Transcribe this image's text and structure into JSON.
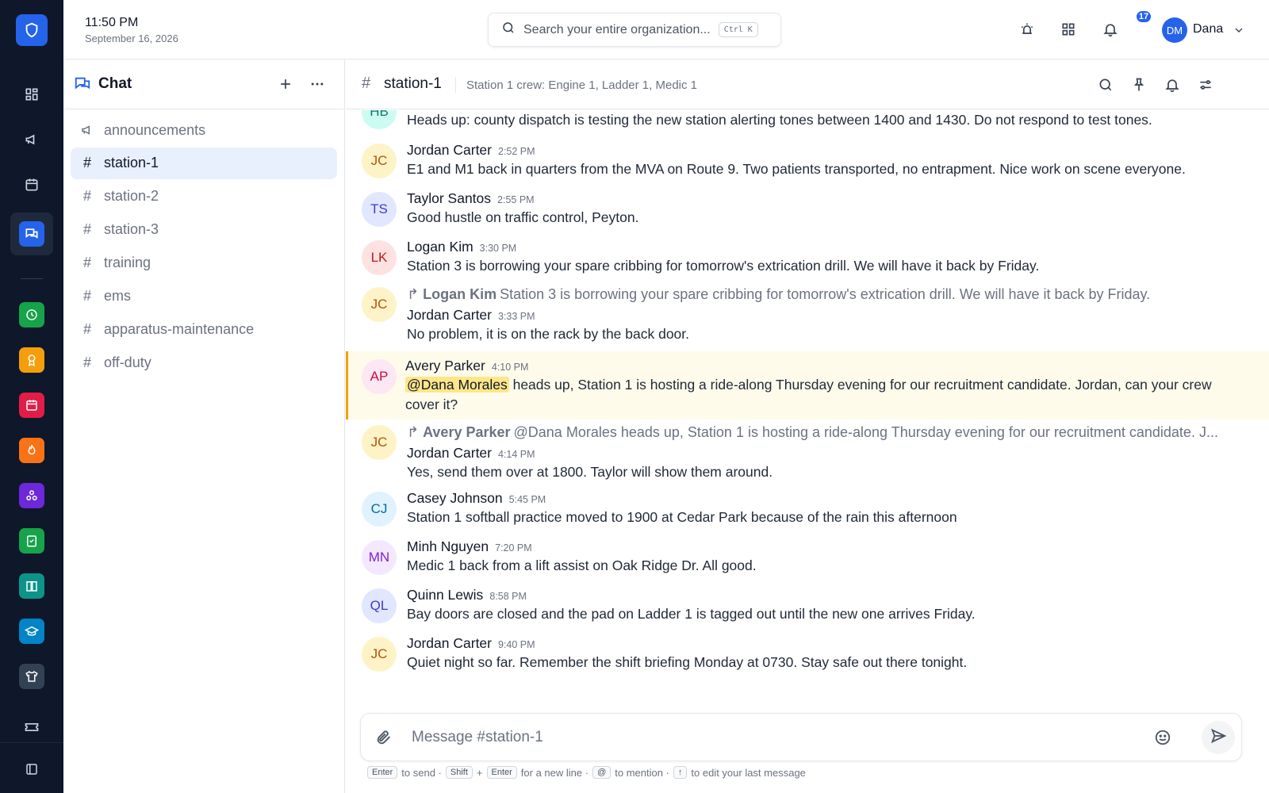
{
  "header": {
    "time": "11:50 PM",
    "date": "September 16, 2026",
    "search_placeholder": "Search your entire organization...",
    "search_shortcut": "Ctrl K",
    "notification_count": "17",
    "user_initials": "DM",
    "user_name": "Dana"
  },
  "rail": {
    "accent": "#2563eb",
    "app_colors": [
      "#16a34a",
      "#f59e0b",
      "#e11d48",
      "#f97316",
      "#6d28d9",
      "#16a34a",
      "#0d9488",
      "#0284c7",
      "#334155"
    ]
  },
  "sidebar": {
    "title": "Chat",
    "channels": [
      {
        "label": "announcements",
        "icon": "megaphone-icon"
      },
      {
        "label": "station-1",
        "icon": "hash-icon"
      },
      {
        "label": "station-2",
        "icon": "hash-icon"
      },
      {
        "label": "station-3",
        "icon": "hash-icon"
      },
      {
        "label": "training",
        "icon": "hash-icon"
      },
      {
        "label": "ems",
        "icon": "hash-icon"
      },
      {
        "label": "apparatus-maintenance",
        "icon": "hash-icon"
      },
      {
        "label": "off-duty",
        "icon": "hash-icon"
      }
    ],
    "active": "station-1"
  },
  "channel": {
    "name": "station-1",
    "topic": "Station 1 crew: Engine 1, Ladder 1, Medic 1"
  },
  "messages": [
    {
      "initials": "HB",
      "author": "",
      "time": "",
      "text": "Heads up: county dispatch is testing the new station alerting tones between 1400 and 1430. Do not respond to test tones."
    },
    {
      "initials": "JC",
      "author": "Jordan Carter",
      "time": "2:52 PM",
      "text": "E1 and M1 back in quarters from the MVA on Route 9. Two patients transported, no entrapment. Nice work on scene everyone."
    },
    {
      "initials": "TS",
      "author": "Taylor Santos",
      "time": "2:55 PM",
      "text": "Good hustle on traffic control, Peyton."
    },
    {
      "initials": "LK",
      "author": "Logan Kim",
      "time": "3:30 PM",
      "text": "Station 3 is borrowing your spare cribbing for tomorrow's extrication drill. We will have it back by Friday."
    },
    {
      "initials": "JC",
      "author": "Jordan Carter",
      "time": "3:33 PM",
      "text": "No problem, it is on the rack by the back door.",
      "reply_author": "Logan Kim",
      "reply_text": "Station 3 is borrowing your spare cribbing for tomorrow's extrication drill. We will have it back by Friday."
    },
    {
      "initials": "AP",
      "author": "Avery Parker",
      "time": "4:10 PM",
      "mention": "@Dana Morales",
      "text": "heads up, Station 1 is hosting a ride-along Thursday evening for our recruitment candidate. Jordan, can your crew cover it?"
    },
    {
      "initials": "JC",
      "author": "Jordan Carter",
      "time": "4:14 PM",
      "text": "Yes, send them over at 1800. Taylor will show them around.",
      "reply_author": "Avery Parker",
      "reply_text": "@Dana Morales heads up, Station 1 is hosting a ride-along Thursday evening for our recruitment candidate. J..."
    },
    {
      "initials": "CJ",
      "author": "Casey Johnson",
      "time": "5:45 PM",
      "text": "Station 1 softball practice moved to 1900 at Cedar Park because of the rain this afternoon"
    },
    {
      "initials": "MN",
      "author": "Minh Nguyen",
      "time": "7:20 PM",
      "text": "Medic 1 back from a lift assist on Oak Ridge Dr. All good."
    },
    {
      "initials": "QL",
      "author": "Quinn Lewis",
      "time": "8:58 PM",
      "text": "Bay doors are closed and the pad on Ladder 1 is tagged out until the new one arrives Friday."
    },
    {
      "initials": "JC",
      "author": "Jordan Carter",
      "time": "9:40 PM",
      "text": "Quiet night so far. Remember the shift briefing Monday at 0730. Stay safe out there tonight."
    }
  ],
  "composer": {
    "placeholder": "Message #station-1",
    "hint_send_key": "Enter",
    "hint_send": "to send ·",
    "hint_shift": "Shift",
    "hint_plus": "+",
    "hint_enter": "Enter",
    "hint_newline": "for a new line ·",
    "hint_at": "@",
    "hint_mention": "to mention ·",
    "hint_up": "↑",
    "hint_edit": "to edit your last message"
  }
}
